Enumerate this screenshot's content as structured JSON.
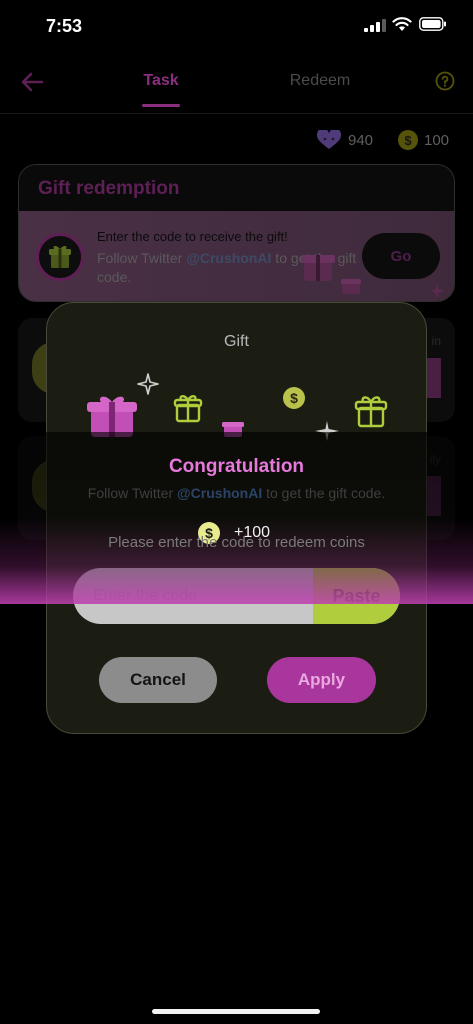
{
  "status_bar": {
    "time": "7:53"
  },
  "nav": {
    "tab_task": "Task",
    "tab_redeem": "Redeem"
  },
  "balance": {
    "hearts": "940",
    "coins": "100"
  },
  "gift_card": {
    "title": "Gift redemption",
    "line1": "Enter the code to receive the gift!",
    "line2_prefix": "Follow Twitter ",
    "line2_handle": "@CrushonAI",
    "line2_suffix": " to get the gift code.",
    "go_label": "Go"
  },
  "task_cards": {
    "corner_a": "in",
    "corner_b": "ily"
  },
  "dialog": {
    "title": "Gift",
    "input_placeholder": "Enter the code",
    "paste_label": "Paste",
    "cancel_label": "Cancel",
    "apply_label": "Apply"
  },
  "toast": {
    "title": "Congratulation",
    "under_prefix": "Follow Twitter ",
    "under_handle": "@CrushonAI",
    "under_suffix": " to get the gift code.",
    "reward": "+100",
    "hint": "Please enter the code to redeem coins"
  },
  "colors": {
    "accent_pink": "#a9369c",
    "accent_green": "#b0cd3d",
    "toast_title": "#e778dc"
  }
}
